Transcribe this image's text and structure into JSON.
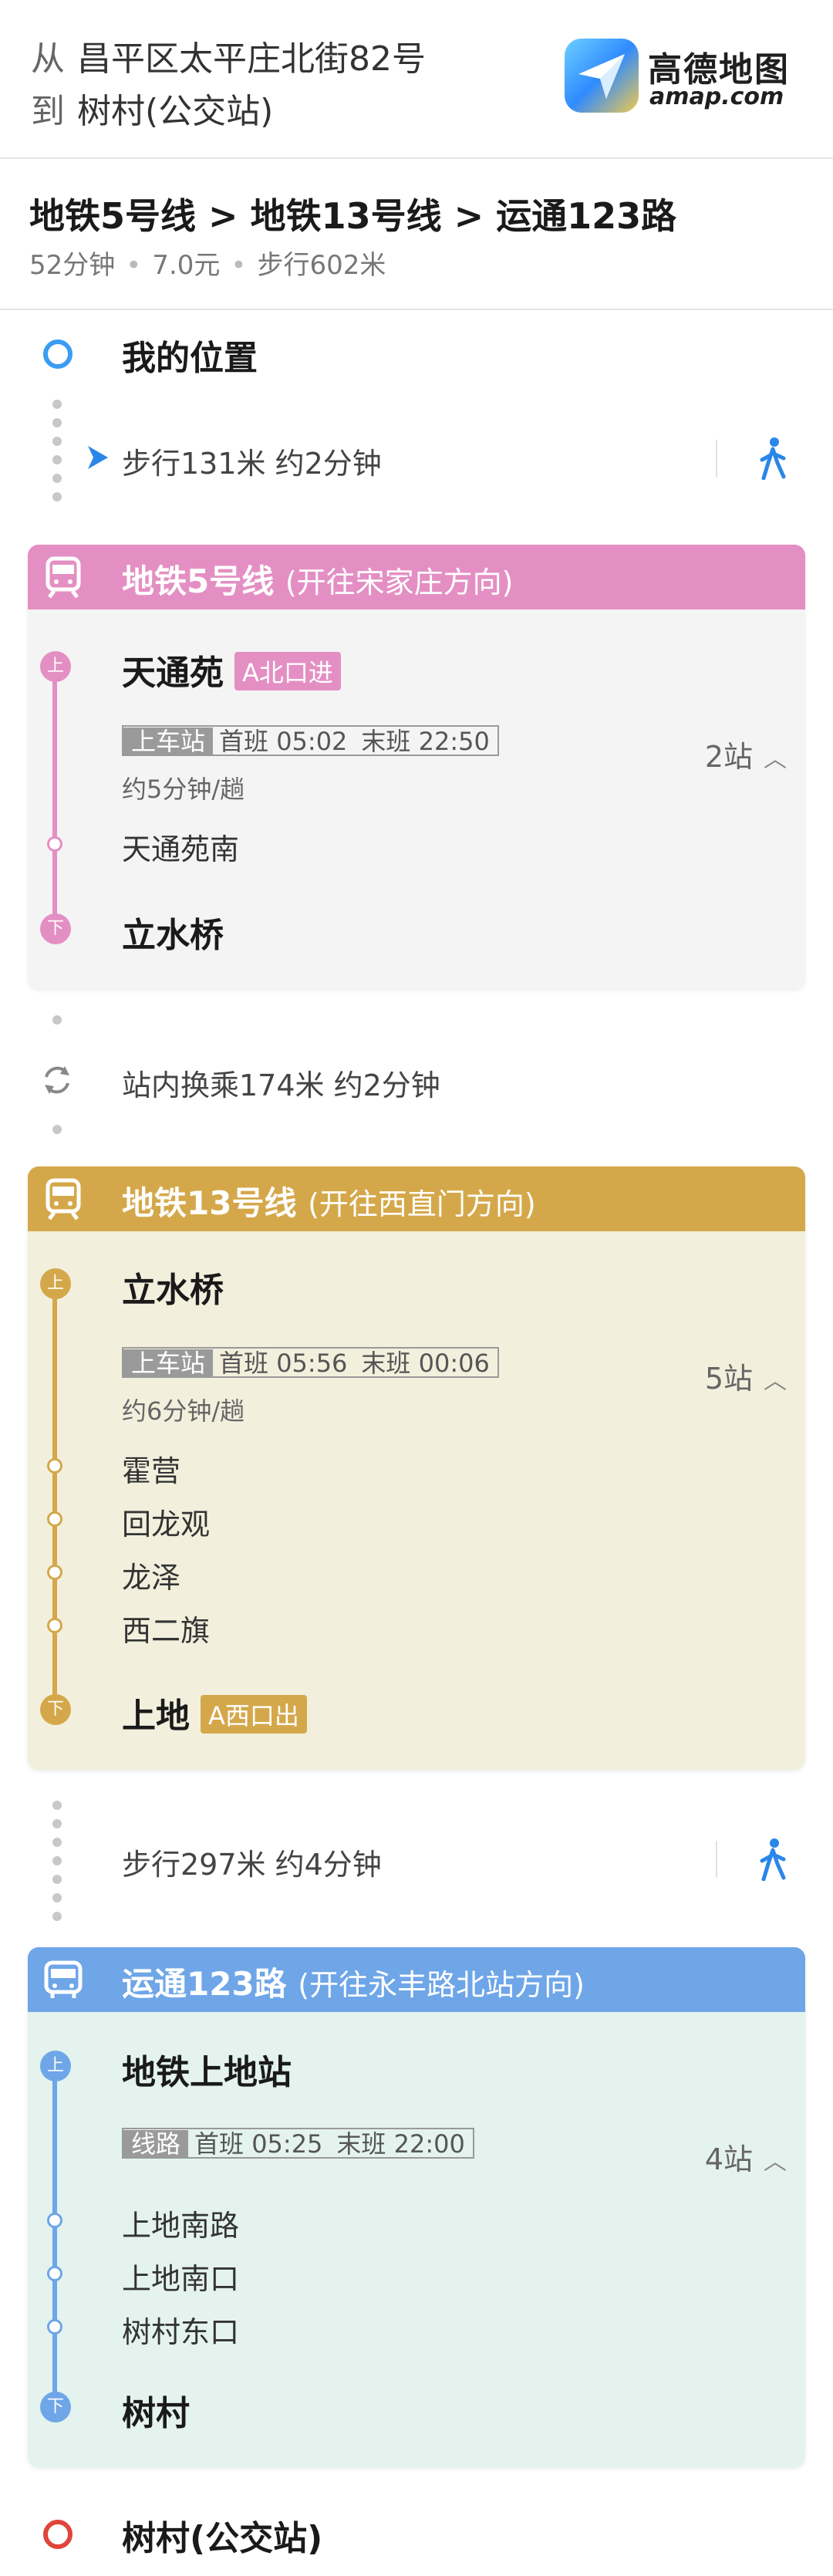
{
  "header": {
    "from_prefix": "从",
    "from": "昌平区太平庄北街82号",
    "to_prefix": "到",
    "to": "树村(公交站)",
    "brand_name": "高德地图",
    "brand_site": "amap.com"
  },
  "summary": {
    "route": "地铁5号线 > 地铁13号线 > 运通123路",
    "duration": "52分钟",
    "fare": "7.0元",
    "walk": "步行602米"
  },
  "origin": {
    "label": "我的位置",
    "color": "#3a9cf2"
  },
  "walk1": {
    "text": "步行131米 约2分钟"
  },
  "line1": {
    "name": "地铁5号线",
    "direction": "(开往宋家庄方向)",
    "color": "#e48fc3",
    "bg": "#f4f4f4",
    "board": "天通苑",
    "board_gate": "A北口进",
    "sched_tag": "上车站",
    "first": "首班 05:02",
    "last": "末班 22:50",
    "freq": "约5分钟/趟",
    "count": "2站",
    "mid_stops": [
      "天通苑南"
    ],
    "alight": "立水桥",
    "up_mark": "上",
    "down_mark": "下"
  },
  "transfer": {
    "text": "站内换乘174米 约2分钟"
  },
  "line2": {
    "name": "地铁13号线",
    "direction": "(开往西直门方向)",
    "color": "#d4a84a",
    "bg": "#f2f0dd",
    "board": "立水桥",
    "sched_tag": "上车站",
    "first": "首班 05:56",
    "last": "末班 00:06",
    "freq": "约6分钟/趟",
    "count": "5站",
    "mid_stops": [
      "霍营",
      "回龙观",
      "龙泽",
      "西二旗"
    ],
    "alight": "上地",
    "alight_gate": "A西口出",
    "up_mark": "上",
    "down_mark": "下"
  },
  "walk2": {
    "text": "步行297米 约4分钟"
  },
  "line3": {
    "name": "运通123路",
    "direction": "(开往永丰路北站方向)",
    "color": "#6ea6e8",
    "bg": "#e4f3ee",
    "board": "地铁上地站",
    "sched_tag": "线路",
    "first": "首班 05:25",
    "last": "末班 22:00",
    "count": "4站",
    "mid_stops": [
      "上地南路",
      "上地南口",
      "树村东口"
    ],
    "alight": "树村",
    "up_mark": "上",
    "down_mark": "下"
  },
  "destination": {
    "label": "树村(公交站)",
    "color": "#e0453a"
  }
}
